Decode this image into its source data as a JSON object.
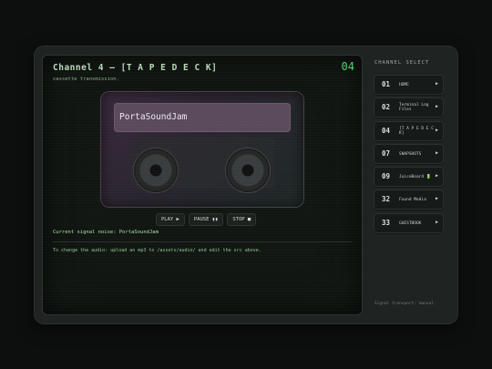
{
  "channel": {
    "title": "Channel 4 — [T A P E D E C K]",
    "number": "04",
    "subtitle": "cassette transmission."
  },
  "cassette": {
    "label": "PortaSoundJam"
  },
  "controls": {
    "play": "PLAY ▶",
    "pause": "PAUSE ▮▮",
    "stop": "STOP ■"
  },
  "now_playing": "Current signal noise: PortaSoundJam",
  "help_text": "To change the audio: upload an mp3 to /assets/audio/ and edit the src above.",
  "sidebar": {
    "title": "CHANNEL SELECT",
    "items": [
      {
        "num": "01",
        "label": "HOME",
        "arrow": "▶"
      },
      {
        "num": "02",
        "label": "Terminal Log Files",
        "arrow": "▶"
      },
      {
        "num": "04",
        "label": "[T A P E D E C K]",
        "arrow": "▶"
      },
      {
        "num": "07",
        "label": "SNAPSHOTS",
        "arrow": "▶"
      },
      {
        "num": "09",
        "label": "JuiceBoard 🔋",
        "arrow": "▶"
      },
      {
        "num": "32",
        "label": "Found Media",
        "arrow": "▶"
      },
      {
        "num": "33",
        "label": "GUESTBOOK",
        "arrow": "▶"
      }
    ],
    "status": "Signal transport: manual."
  }
}
